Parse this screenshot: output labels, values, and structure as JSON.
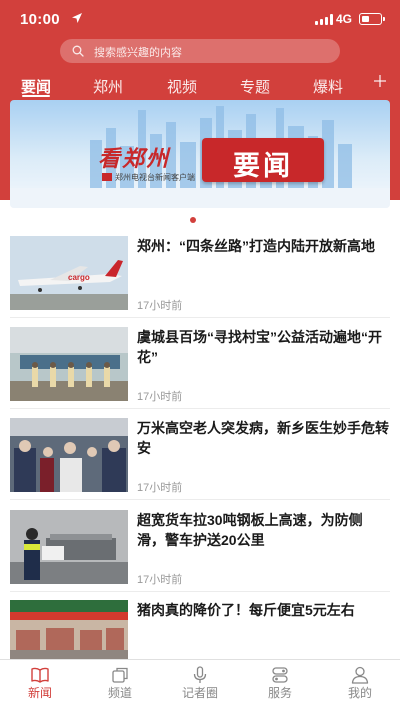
{
  "status_bar": {
    "time": "10:00",
    "network": "4G",
    "battery_level": 0.4
  },
  "search": {
    "placeholder": "搜索感兴趣的内容"
  },
  "tabs": [
    {
      "label": "要闻",
      "active": true
    },
    {
      "label": "郑州",
      "active": false
    },
    {
      "label": "视频",
      "active": false
    },
    {
      "label": "专题",
      "active": false
    },
    {
      "label": "爆料",
      "active": false
    }
  ],
  "banner": {
    "brand": "看郑州",
    "subtitle": "郑州电视台新闻客户端",
    "title": "要闻",
    "page_indicator": {
      "count": 1,
      "active": 1
    }
  },
  "news": [
    {
      "title": "郑州：“四条丝路”打造内陆开放新高地",
      "time": "17小时前"
    },
    {
      "title": "虞城县百场“寻找村宝”公益活动遍地“开花”",
      "time": "17小时前"
    },
    {
      "title": "万米高空老人突发病，新乡医生妙手危转安",
      "time": "17小时前"
    },
    {
      "title": "超宽货车拉30吨钢板上高速，为防侧滑，警车护送20公里",
      "time": "17小时前"
    },
    {
      "title": "猪肉真的降价了！每斤便宜5元左右",
      "time": ""
    }
  ],
  "bottom_nav": [
    {
      "label": "新闻",
      "icon": "book-icon",
      "active": true
    },
    {
      "label": "频道",
      "icon": "channel-icon",
      "active": false
    },
    {
      "label": "记者圈",
      "icon": "microphone-icon",
      "active": false
    },
    {
      "label": "服务",
      "icon": "service-icon",
      "active": false
    },
    {
      "label": "我的",
      "icon": "user-icon",
      "active": false
    }
  ],
  "colors": {
    "brand_red": "#d2403c",
    "inactive_gray": "#888888"
  }
}
